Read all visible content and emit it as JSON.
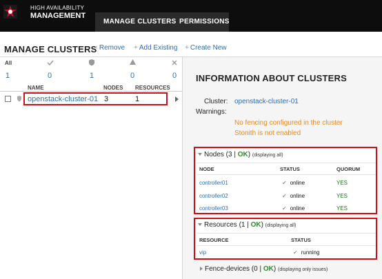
{
  "header": {
    "brand_line1": "HIGH AVAILABILITY",
    "brand_line2": "MANAGEMENT",
    "nav": [
      {
        "label": "MANAGE CLUSTERS"
      },
      {
        "label": "PERMISSIONS"
      }
    ]
  },
  "clusters_page": {
    "title": "MANAGE CLUSTERS",
    "actions": [
      {
        "icon": "×",
        "label": "Remove"
      },
      {
        "icon": "+",
        "label": "Add Existing"
      },
      {
        "icon": "+",
        "label": "Create New"
      }
    ],
    "status_summary": {
      "all_label": "All",
      "counts": [
        "1",
        "0",
        "1",
        "0",
        "0"
      ]
    },
    "columns": [
      "NAME",
      "NODES",
      "RESOURCES"
    ],
    "rows": [
      {
        "name": "openstack-cluster-01",
        "nodes": "3",
        "resources": "1"
      }
    ]
  },
  "info": {
    "title": "INFORMATION ABOUT CLUSTERS",
    "cluster_label": "Cluster:",
    "cluster_name": "openstack-cluster-01",
    "warnings_label": "Warnings:",
    "warnings": [
      "No fencing configured in the cluster",
      "Stonith is not enabled"
    ]
  },
  "nodes_section": {
    "title": "Nodes (3 |",
    "ok": "OK",
    "title_end": ")",
    "note": "(displaying all)",
    "columns": [
      "NODE",
      "STATUS",
      "QUORUM"
    ],
    "rows": [
      {
        "node": "controller01",
        "status": "online",
        "quorum": "YES"
      },
      {
        "node": "controller02",
        "status": "online",
        "quorum": "YES"
      },
      {
        "node": "controller03",
        "status": "online",
        "quorum": "YES"
      }
    ]
  },
  "resources_section": {
    "title": "Resources (1 |",
    "ok": "OK",
    "title_end": ")",
    "note": "(displaying all)",
    "columns": [
      "RESOURCE",
      "STATUS"
    ],
    "rows": [
      {
        "resource": "vip",
        "status": "running"
      }
    ]
  },
  "fence_section": {
    "title": "Fence-devices (0 |",
    "ok": "OK",
    "title_end": ")",
    "note": "(displaying only issues)"
  },
  "colors": {
    "header_bg": "#0d0d0d",
    "link": "#2a6eb5",
    "warning": "#e8891a",
    "ok": "#2e8b2e",
    "highlight_box": "#cc1111"
  },
  "icons": {
    "logo": "redhat-shadowman-icon",
    "check": "check-icon",
    "shield": "shield-icon",
    "warning": "warning-icon",
    "close": "close-icon"
  }
}
